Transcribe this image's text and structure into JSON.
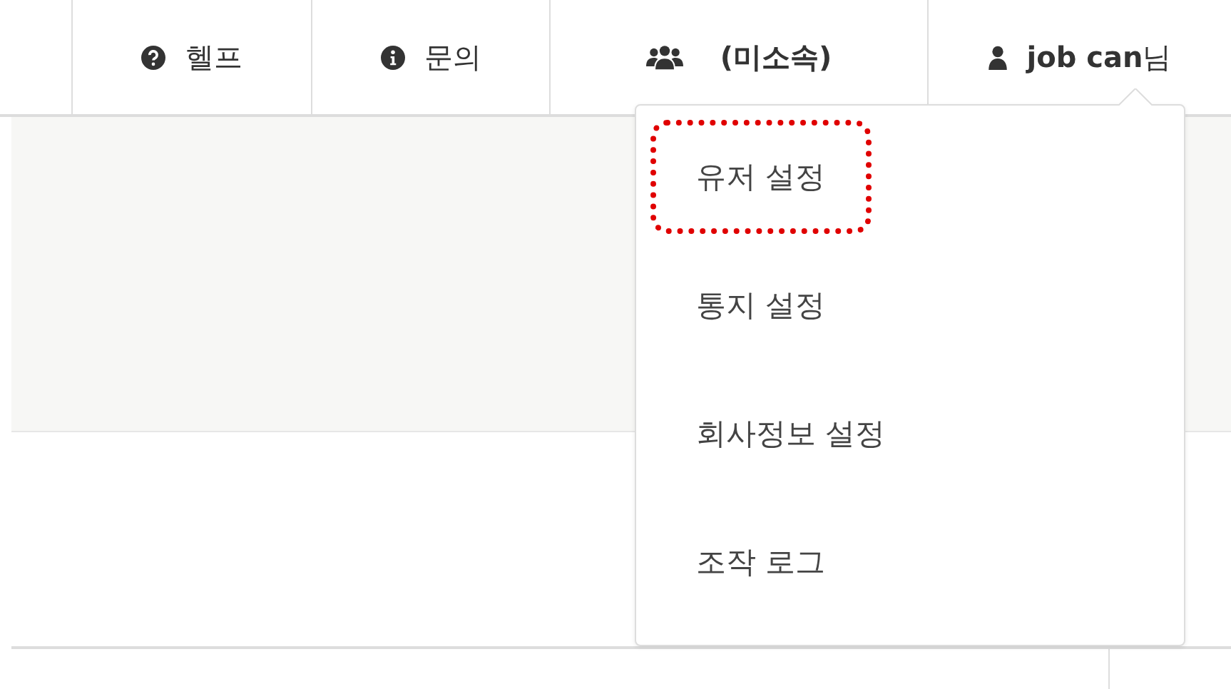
{
  "nav": [
    {
      "kind": "help",
      "label": "헬프"
    },
    {
      "kind": "info",
      "label": "문의"
    },
    {
      "kind": "group",
      "label": "(미소속)"
    },
    {
      "kind": "user",
      "label": "**job can**님"
    }
  ],
  "user_menu": {
    "items": [
      {
        "label": "유저 설정",
        "highlighted": true
      },
      {
        "label": "통지 설정",
        "highlighted": false
      },
      {
        "label": "회사정보 설정",
        "highlighted": false
      },
      {
        "label": "조작 로그",
        "highlighted": false
      }
    ]
  }
}
